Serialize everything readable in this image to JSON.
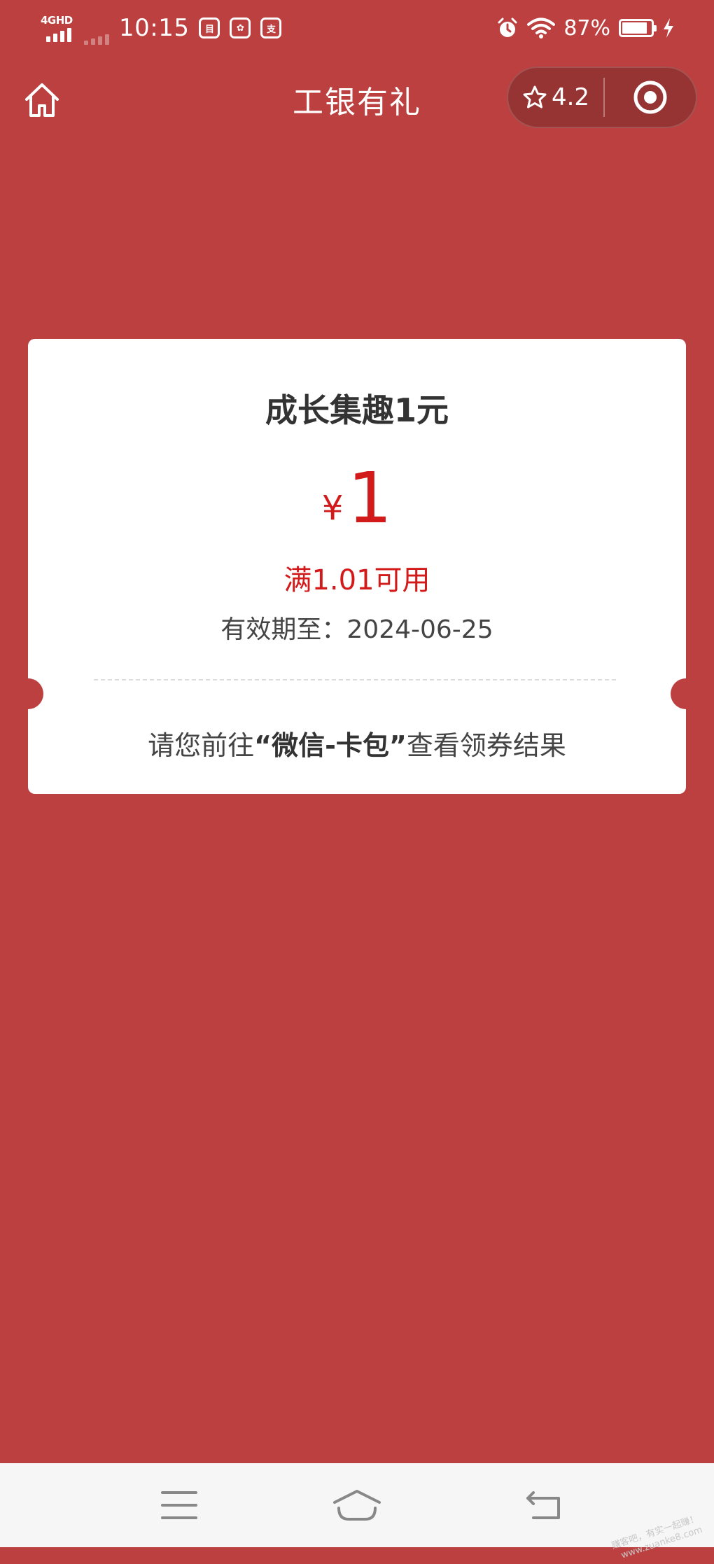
{
  "status_bar": {
    "network_label": "4GHD",
    "time": "10:15",
    "app_icons": [
      "notes-icon",
      "mascot-icon",
      "payment-icon"
    ],
    "app_icon_glyphs": [
      "目",
      "✿",
      "支"
    ],
    "battery_percent": "87%",
    "battery_level": 0.87
  },
  "nav_bar": {
    "title": "工银有礼",
    "rating": "4.2"
  },
  "coupon": {
    "title": "成长集趣1元",
    "currency_symbol": "¥",
    "amount": "1",
    "condition": "满1.01可用",
    "expiry": "有效期至：2024-06-25",
    "tip_prefix": "请您前往",
    "tip_highlight": "“微信-卡包”",
    "tip_suffix": "查看领券结果"
  },
  "watermark": {
    "line1": "赚客吧，有实一起赚！",
    "line2": "www.zuanke8.com"
  },
  "colors": {
    "background": "#bc4040",
    "capsule": "#963434",
    "coupon_red": "#d21a1a",
    "card": "#ffffff",
    "system_nav": "#f6f6f6"
  }
}
